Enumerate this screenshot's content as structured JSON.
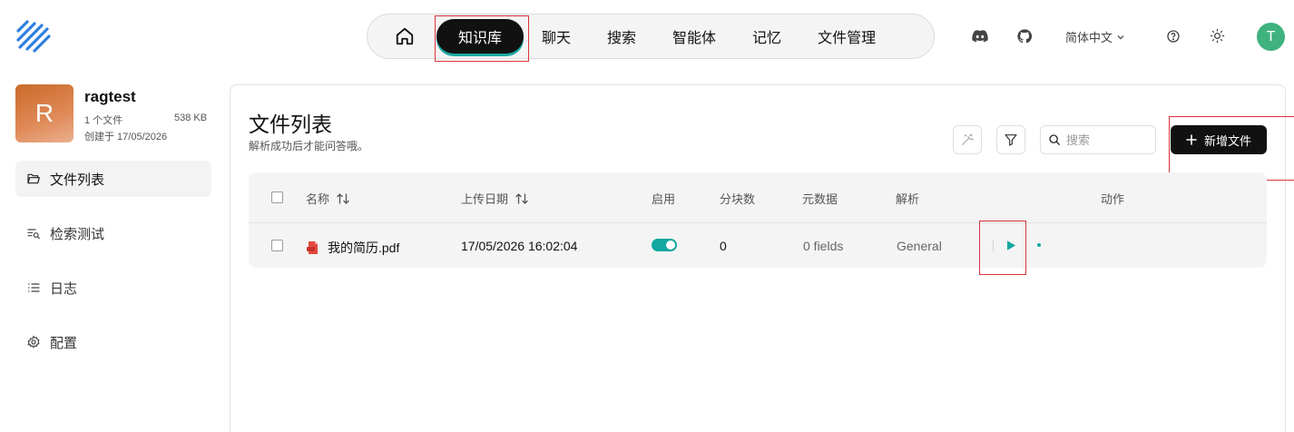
{
  "colors": {
    "accent": "#12a8a0",
    "highlight": "#d9343a",
    "primary_button": "#111111",
    "avatar_green": "#3fb27f",
    "kb_avatar": "#d27a45"
  },
  "nav": {
    "home_icon": "home-icon",
    "tabs": [
      {
        "label": "知识库",
        "active": true
      },
      {
        "label": "聊天"
      },
      {
        "label": "搜索"
      },
      {
        "label": "智能体"
      },
      {
        "label": "记忆"
      },
      {
        "label": "文件管理"
      }
    ]
  },
  "topbar": {
    "language": "简体中文",
    "user_initial": "T"
  },
  "knowledge_base": {
    "initial": "R",
    "name": "ragtest",
    "file_count": "1 个文件",
    "size": "538 KB",
    "created": "创建于 17/05/2026"
  },
  "sidebar": {
    "items": [
      {
        "label": "文件列表",
        "active": true
      },
      {
        "label": "检索测试"
      },
      {
        "label": "日志"
      },
      {
        "label": "配置"
      }
    ]
  },
  "main": {
    "title": "文件列表",
    "subtitle": "解析成功后才能问答哦。",
    "search_placeholder": "搜索",
    "add_button": "新增文件"
  },
  "table": {
    "headers": {
      "name": "名称",
      "upload_date": "上传日期",
      "enabled": "启用",
      "chunks": "分块数",
      "metadata": "元数据",
      "parse": "解析",
      "actions": "动作"
    },
    "rows": [
      {
        "name": "我的简历.pdf",
        "upload_date": "17/05/2026 16:02:04",
        "enabled": true,
        "chunks": "0",
        "metadata": "0 fields",
        "parser": "General"
      }
    ]
  }
}
